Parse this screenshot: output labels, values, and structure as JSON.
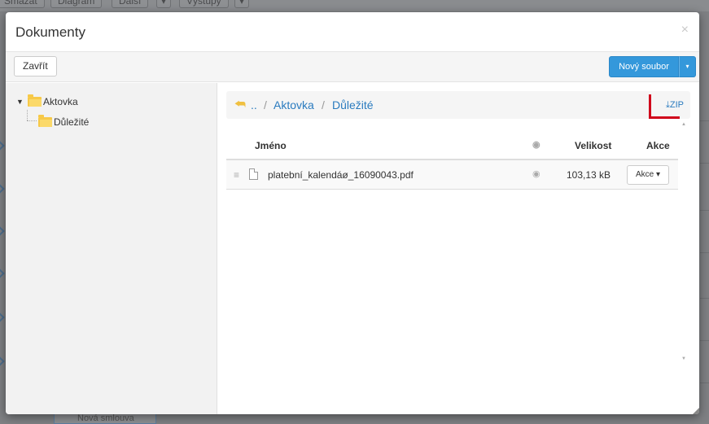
{
  "background": {
    "toolbar": [
      "Smazat",
      "Diagram",
      "Další",
      "▾",
      "Výstupy",
      "▾"
    ],
    "bottom_button": "Nová smlouva"
  },
  "modal": {
    "title": "Dokumenty",
    "close_symbol": "×",
    "toolbar": {
      "close_label": "Zavřít",
      "new_file_label": "Nový soubor",
      "new_file_caret": "▾"
    },
    "tree": {
      "root": {
        "label": "Aktovka",
        "expanded": true
      },
      "children": [
        {
          "label": "Důležité"
        }
      ]
    },
    "breadcrumb": {
      "back_icon": "back-arrow-icon",
      "up": "..",
      "separator": "/",
      "items": [
        "Aktovka",
        "Důležité"
      ],
      "zip_label": "ZIP"
    },
    "table": {
      "columns": {
        "name": "Jméno",
        "visibility": "eye-icon",
        "size": "Velikost",
        "actions": "Akce"
      },
      "rows": [
        {
          "name": "platební_kalendáø_16090043.pdf",
          "size": "103,13 kB",
          "action_label": "Akce ▾"
        }
      ]
    }
  },
  "colors": {
    "accent": "#3498db",
    "link": "#2a7bbf",
    "folder": "#f7c948",
    "annotation": "#d0021b"
  }
}
